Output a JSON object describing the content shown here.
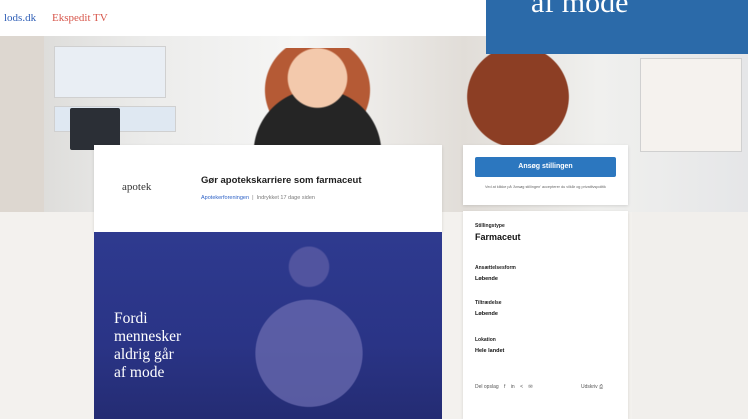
{
  "topbar": {
    "site_a": "lods.dk",
    "site_b": "Ekspedit TV"
  },
  "banner": {
    "text": "af mode"
  },
  "job": {
    "logo": "apotek",
    "title": "Gør apotekskarriere som farmaceut",
    "company": "Apotekerforeningen",
    "posted": "Indrykket 17 dage siden"
  },
  "apply": {
    "button_label": "Ansøg stillingen",
    "note": "Ved at klikke på 'Ansøg stillingen' accepterer du vilkår og privatlivspolitik"
  },
  "details": {
    "stillingstype_label": "Stillingstype",
    "stillingstype_value": "Farmaceut",
    "ansaettelse_label": "Ansættelsesform",
    "ansaettelse_value": "Løbende",
    "tiltraedelse_label": "Tiltrædelse",
    "tiltraedelse_value": "Løbende",
    "lokation_label": "Lokation",
    "lokation_value": "Hele landet",
    "share_label": "Del opslag",
    "print_label": "Udskriv"
  },
  "promo": {
    "text": "Fordi\nmennesker\naldrig går\naf mode"
  },
  "colors": {
    "accent": "#2c77bf",
    "banner": "#2b6aa9",
    "promo": "#2e3a8f"
  }
}
